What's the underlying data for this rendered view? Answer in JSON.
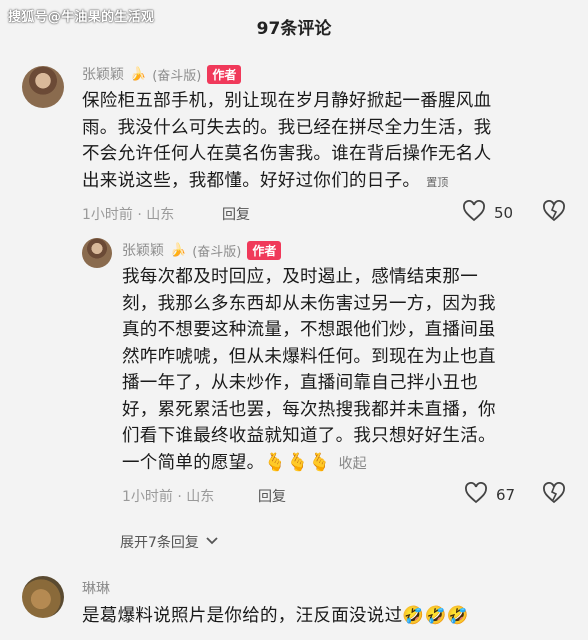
{
  "watermark": "搜狐号@牛油果的生活观",
  "header": {
    "title": "97条评论"
  },
  "comments": [
    {
      "name": "张颖颖",
      "badge_emoji": "🍌",
      "tag": "(奋斗版)",
      "author_label": "作者",
      "lines": [
        "保险柜五部手机，别让现在岁月静好掀起一番腥风血",
        "雨。我没什么可失去的。我已经在拼尽全力生活，我",
        "不会允许任何人在莫名伤害我。谁在背后操作无名人",
        "出来说这些，我都懂。好好过你们的日子。"
      ],
      "pinned_label": "置顶",
      "time": "1小时前 · 山东",
      "reply_label": "回复",
      "likes": "50"
    },
    {
      "name": "张颖颖",
      "badge_emoji": "🍌",
      "tag": "(奋斗版)",
      "author_label": "作者",
      "lines": [
        "我每次都及时回应，及时遏止，感情结束那一",
        "刻，我那么多东西却从未伤害过另一方，因为我",
        "真的不想要这种流量，不想跟他们炒，直播间虽",
        "然咋咋唬唬，但从未爆料任何。到现在为止也直",
        "播一年了，从未炒作，直播间靠自己拌小丑也",
        "好，累死累活也罢，每次热搜我都并未直播，你",
        "们看下谁最终收益就知道了。我只想好好生活。",
        "一个简单的愿望。🫰🫰🫰"
      ],
      "collapse_label": "收起",
      "time": "1小时前 · 山东",
      "reply_label": "回复",
      "likes": "67"
    },
    {
      "name": "琳琳",
      "lines": [
        "是葛爆料说照片是你给的，汪反面没说过🤣🤣🤣"
      ]
    }
  ],
  "expand_label": "展开7条回复",
  "icons": {
    "heart": "heart-icon",
    "dislike": "broken-heart-icon",
    "chevron": "chevron-down-icon"
  },
  "colors": {
    "author_badge": "#f0395a",
    "background": "#f3f3f3"
  }
}
